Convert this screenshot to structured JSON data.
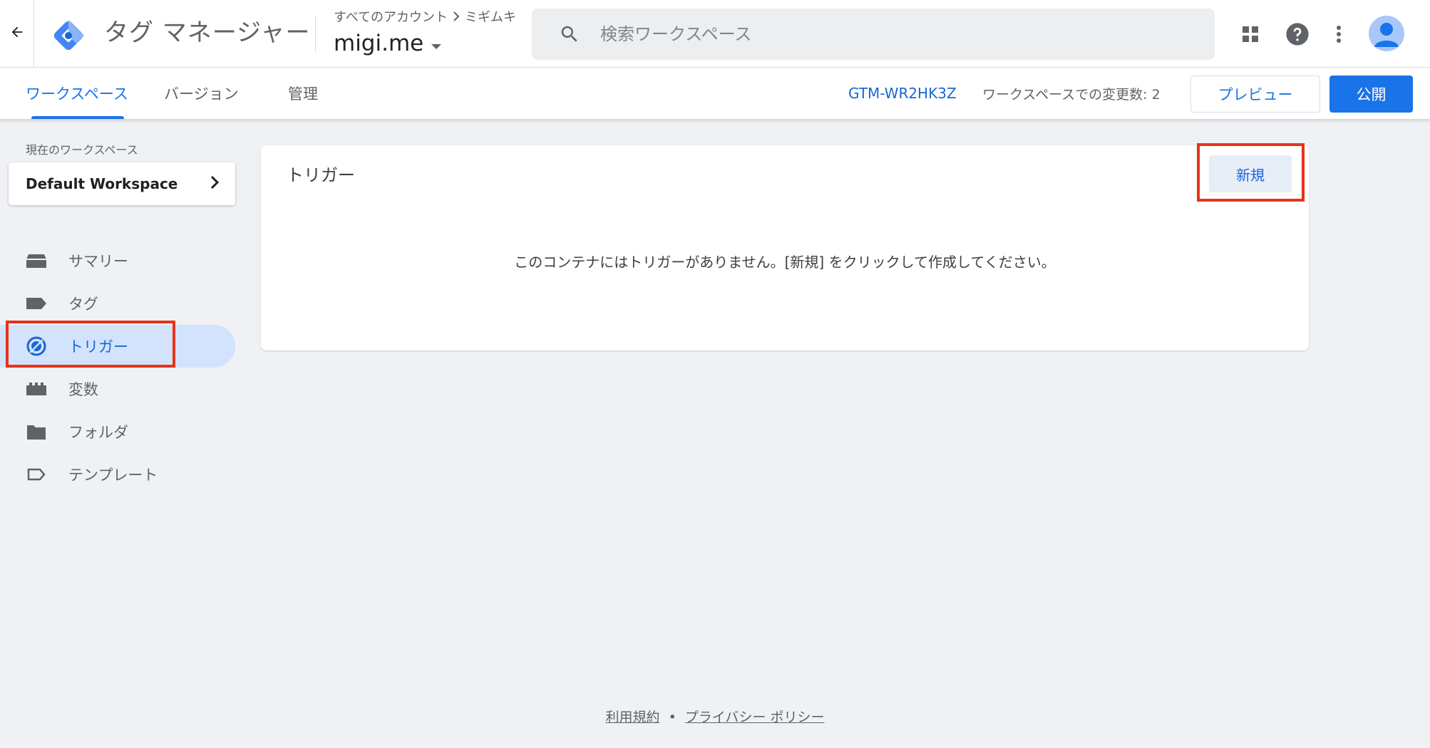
{
  "header": {
    "product_name": "タグ マネージャー",
    "breadcrumb": {
      "root": "すべてのアカウント",
      "account": "ミギムキ"
    },
    "container_name": "migi.me",
    "search": {
      "placeholder": "検索ワークスペース"
    },
    "icons": {
      "back": "arrow-back-icon",
      "logo": "gtm-logo-icon",
      "search": "search-icon",
      "apps": "apps-grid-icon",
      "help": "help-icon",
      "more": "more-vert-icon",
      "avatar": "account-avatar-icon"
    }
  },
  "subbar": {
    "tabs": [
      {
        "label": "ワークスペース",
        "active": true
      },
      {
        "label": "バージョン",
        "active": false
      },
      {
        "label": "管理",
        "active": false
      }
    ],
    "container_id": "GTM-WR2HK3Z",
    "workspace_changes": "ワークスペースでの変更数: 2",
    "preview_label": "プレビュー",
    "publish_label": "公開"
  },
  "sidebar": {
    "current_workspace_label": "現在のワークスペース",
    "workspace_name": "Default Workspace",
    "items": [
      {
        "label": "サマリー",
        "icon": "summary-icon"
      },
      {
        "label": "タグ",
        "icon": "tag-icon"
      },
      {
        "label": "トリガー",
        "icon": "trigger-icon",
        "active": true
      },
      {
        "label": "変数",
        "icon": "variables-icon"
      },
      {
        "label": "フォルダ",
        "icon": "folder-icon"
      },
      {
        "label": "テンプレート",
        "icon": "template-icon"
      }
    ]
  },
  "main": {
    "card_title": "トリガー",
    "new_label": "新規",
    "empty_message": "このコンテナにはトリガーがありません。[新規] をクリックして作成してください。"
  },
  "footer": {
    "terms_label": "利用規約",
    "separator": "•",
    "privacy_label": "プライバシー ポリシー"
  },
  "colors": {
    "accent": "#1a73e8",
    "highlight_box": "#e53419",
    "active_nav_bg": "#d3e3fd",
    "page_bg": "#eff1f4"
  }
}
